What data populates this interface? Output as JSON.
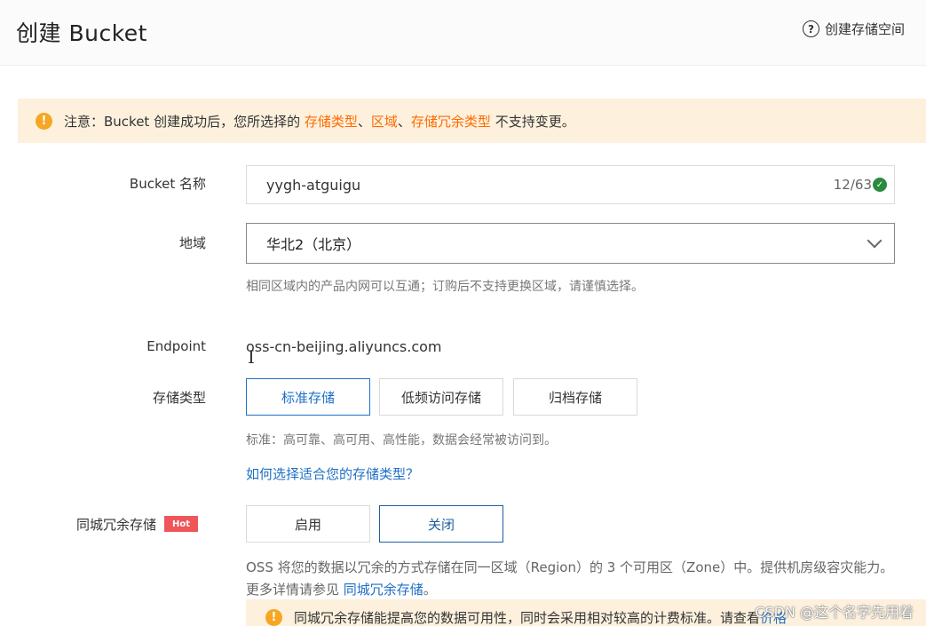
{
  "header": {
    "title": "创建 Bucket",
    "help_label": "创建存储空间"
  },
  "notice": {
    "prefix": "注意：Bucket 创建成功后，您所选择的 ",
    "hl1": "存储类型",
    "sep1": "、",
    "hl2": "区域",
    "sep2": "、",
    "hl3": "存储冗余类型",
    "suffix": " 不支持变更。"
  },
  "form": {
    "bucket_name": {
      "label": "Bucket 名称",
      "value": "yygh-atguigu",
      "counter": "12/63"
    },
    "region": {
      "label": "地域",
      "value": "华北2（北京）",
      "hint": "相同区域内的产品内网可以互通；订购后不支持更换区域，请谨慎选择。"
    },
    "endpoint": {
      "label": "Endpoint",
      "value": "oss-cn-beijing.aliyuncs.com"
    },
    "storage_class": {
      "label": "存储类型",
      "options": [
        "标准存储",
        "低频访问存储",
        "归档存储"
      ],
      "selected": "标准存储",
      "hint": "标准：高可靠、高可用、高性能，数据会经常被访问到。",
      "help_link": "如何选择适合您的存储类型？"
    },
    "redundancy": {
      "label": "同城冗余存储",
      "badge": "Hot",
      "options": [
        "启用",
        "关闭"
      ],
      "selected": "关闭",
      "desc_text": "OSS 将您的数据以冗余的方式存储在同一区域（Region）的 3 个可用区（Zone）中。提供机房级容灾能力。更多详情请参见 ",
      "desc_link": "同城冗余存储",
      "desc_end": "。",
      "notice_text": "同城冗余存储能提高您的数据可用性，同时会采用相对较高的计费标准。请查看 ",
      "notice_link": "价格"
    }
  },
  "watermark": "CSDN @这个名字先用着",
  "colors": {
    "accent": "#1f6fc5",
    "highlight": "#ff6a00",
    "notice_bg": "#fdf1dd",
    "warn": "#f5a623",
    "hot": "#f0555a"
  }
}
